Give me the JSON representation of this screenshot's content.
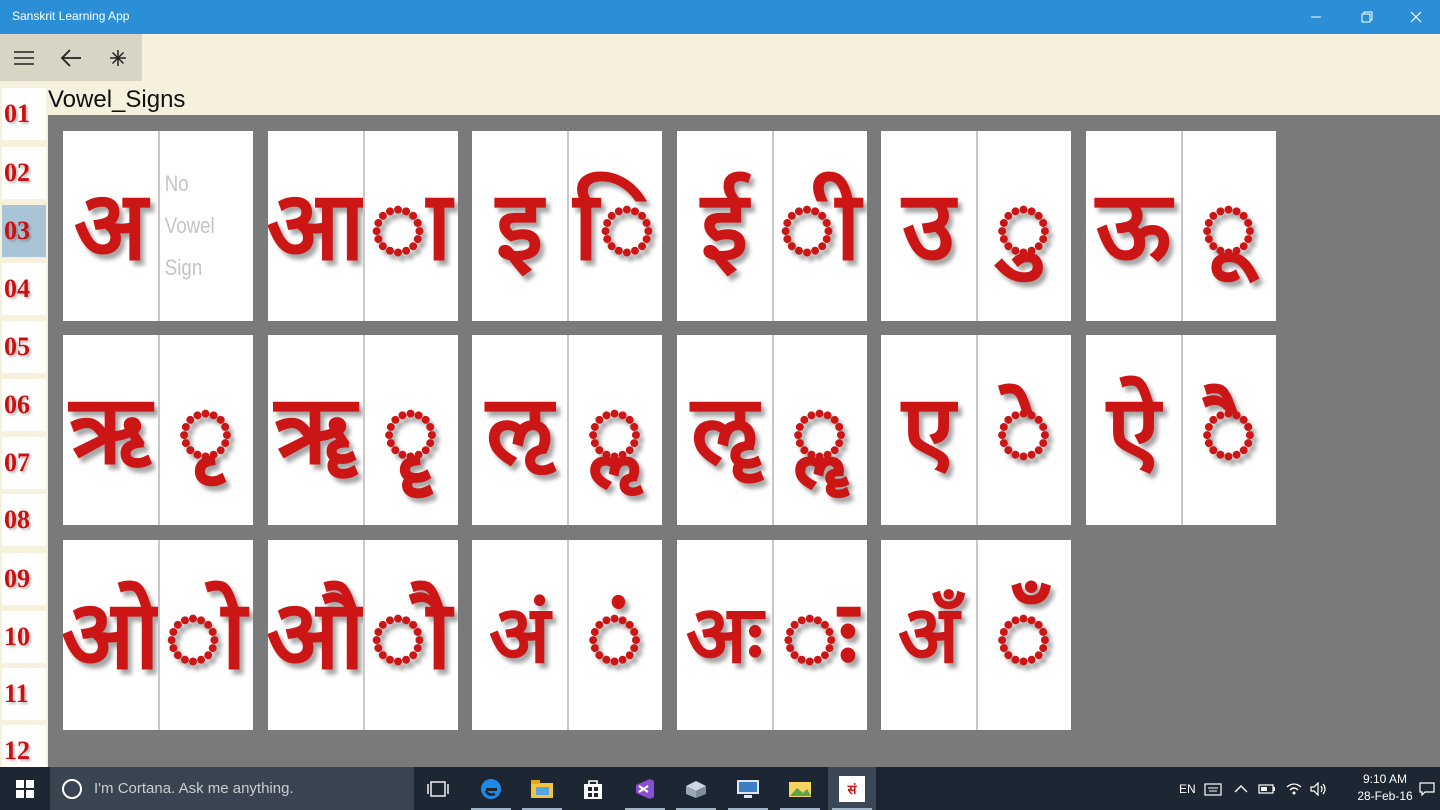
{
  "window": {
    "title": "Sanskrit Learning App"
  },
  "page": {
    "title": "Vowel_Signs"
  },
  "lessons": [
    "01",
    "02",
    "03",
    "04",
    "05",
    "06",
    "07",
    "08",
    "09",
    "10",
    "11",
    "12"
  ],
  "active_lesson": "03",
  "cards": [
    {
      "vowel": "अ",
      "sign": "",
      "no_sign_text": "No Vowel Sign"
    },
    {
      "vowel": "आ",
      "sign": "ा"
    },
    {
      "vowel": "इ",
      "sign": "ि"
    },
    {
      "vowel": "ई",
      "sign": "ी"
    },
    {
      "vowel": "उ",
      "sign": "ु"
    },
    {
      "vowel": "ऊ",
      "sign": "ू"
    },
    {
      "vowel": "ऋ",
      "sign": "ृ"
    },
    {
      "vowel": "ॠ",
      "sign": "ॄ"
    },
    {
      "vowel": "ऌ",
      "sign": "ॢ"
    },
    {
      "vowel": "ॡ",
      "sign": "ॣ"
    },
    {
      "vowel": "ए",
      "sign": "े"
    },
    {
      "vowel": "ऐ",
      "sign": "ै"
    },
    {
      "vowel": "ओ",
      "sign": "ो"
    },
    {
      "vowel": "औ",
      "sign": "ौ"
    },
    {
      "vowel": "अं",
      "sign": "ं"
    },
    {
      "vowel": "अः",
      "sign": "ः"
    },
    {
      "vowel": "अँ",
      "sign": "ँ"
    }
  ],
  "taskbar": {
    "cortana_placeholder": "I'm Cortana. Ask me anything.",
    "language": "EN",
    "time": "9:10 AM",
    "date": "28-Feb-16",
    "active_app_glyph": "सं"
  },
  "colors": {
    "titlebar": "#2a8fd6",
    "accent_red": "#cc1515",
    "app_bg": "#f5f1dc",
    "grid_bg": "#7a7a7a",
    "taskbar": "#1c2733"
  }
}
